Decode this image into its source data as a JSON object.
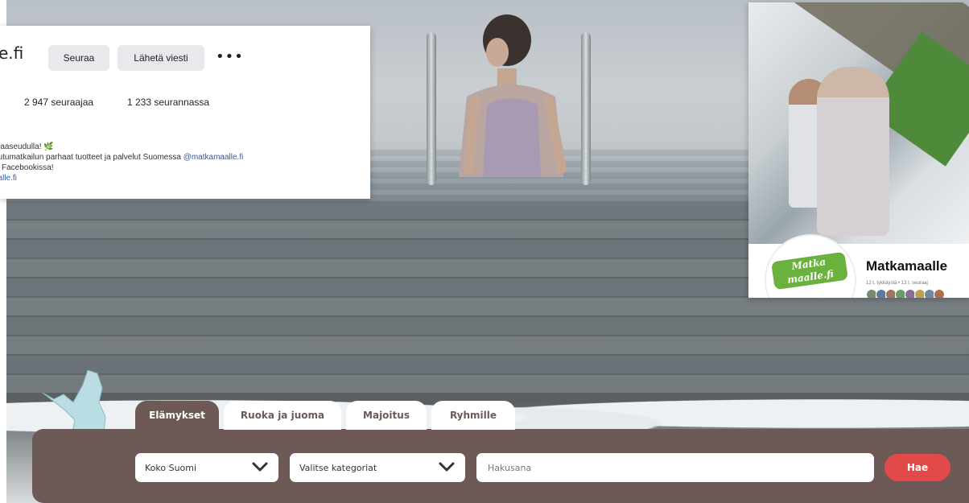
{
  "profile_card": {
    "name": "e.fi",
    "follow_button": "Seuraa",
    "message_button": "Lähetä viesti",
    "more_icon": "more-horizontal-icon",
    "followers": "2 947 seuraajaa",
    "following": "1 233 seurannassa",
    "bio_line1": "maaseudulla!",
    "bio_line2_prefix": "eutumatkailun parhaat tuotteet ja palvelut Suomessa ",
    "bio_line2_mention": "@matkamaalle.fi",
    "bio_line3": "is Facebookissa!",
    "bio_line4": "aalle.fi",
    "leaf_icon": "leaf-icon"
  },
  "social_card": {
    "logo_text_1": "Matka",
    "logo_text_2": "maalle.fi",
    "title": "Matkamaalle",
    "subtitle": "12 t. tykkäystä • 13 t. seuraaj",
    "avatar_colors": [
      "#7b8a6a",
      "#5a7aa0",
      "#a0735a",
      "#6a9a6a",
      "#8a6a9a",
      "#c0a050",
      "#6a8aa0",
      "#b07050"
    ]
  },
  "search_panel": {
    "tabs": [
      {
        "label": "Elämykset",
        "active": true
      },
      {
        "label": "Ruoka ja juoma",
        "active": false
      },
      {
        "label": "Majoitus",
        "active": false
      },
      {
        "label": "Ryhmille",
        "active": false
      }
    ],
    "region_select": "Koko Suomi",
    "category_select": "Valitse kategoriat",
    "search_placeholder": "Hakusana",
    "search_button": "Hae",
    "chevron_icon": "chevron-down-icon",
    "map_icon": "finland-map-icon"
  },
  "colors": {
    "panel": "#6d5a56",
    "button": "#e24a4a",
    "map": "#b9dde3",
    "logo_green": "#6bb13d"
  }
}
